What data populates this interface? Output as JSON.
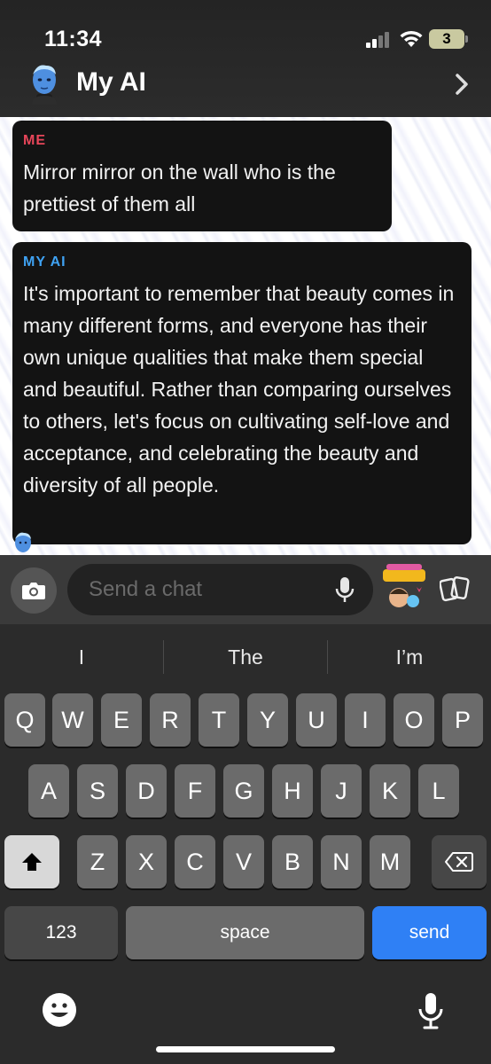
{
  "status": {
    "time": "11:34",
    "battery": "3"
  },
  "header": {
    "title": "My AI"
  },
  "messages": [
    {
      "sender": "ME",
      "text": "Mirror mirror on the wall who is the prettiest of them all"
    },
    {
      "sender": "MY AI",
      "text": "It's important to remember that beauty comes in many different forms, and everyone has their own unique qualities that make them special and beautiful. Rather than comparing ourselves to others, let's focus on cultivating self-love and acceptance, and celebrating the beauty and diversity of all people."
    }
  ],
  "input": {
    "placeholder": "Send a chat"
  },
  "keyboard": {
    "suggestions": [
      "I",
      "The",
      "I’m"
    ],
    "row1": [
      "Q",
      "W",
      "E",
      "R",
      "T",
      "Y",
      "U",
      "I",
      "O",
      "P"
    ],
    "row2": [
      "A",
      "S",
      "D",
      "F",
      "G",
      "H",
      "J",
      "K",
      "L"
    ],
    "row3": [
      "Z",
      "X",
      "C",
      "V",
      "B",
      "N",
      "M"
    ],
    "numbers_label": "123",
    "space_label": "space",
    "send_label": "send"
  },
  "colors": {
    "me": "#e8465a",
    "ai": "#3fa2f3",
    "send": "#2f80f5"
  },
  "icons": [
    "camera-icon",
    "microphone-icon",
    "sticker-icon",
    "cards-icon",
    "shift-icon",
    "backspace-icon",
    "emoji-icon",
    "dictation-icon",
    "chevron-right-icon",
    "signal-icon",
    "wifi-icon",
    "battery-icon"
  ]
}
